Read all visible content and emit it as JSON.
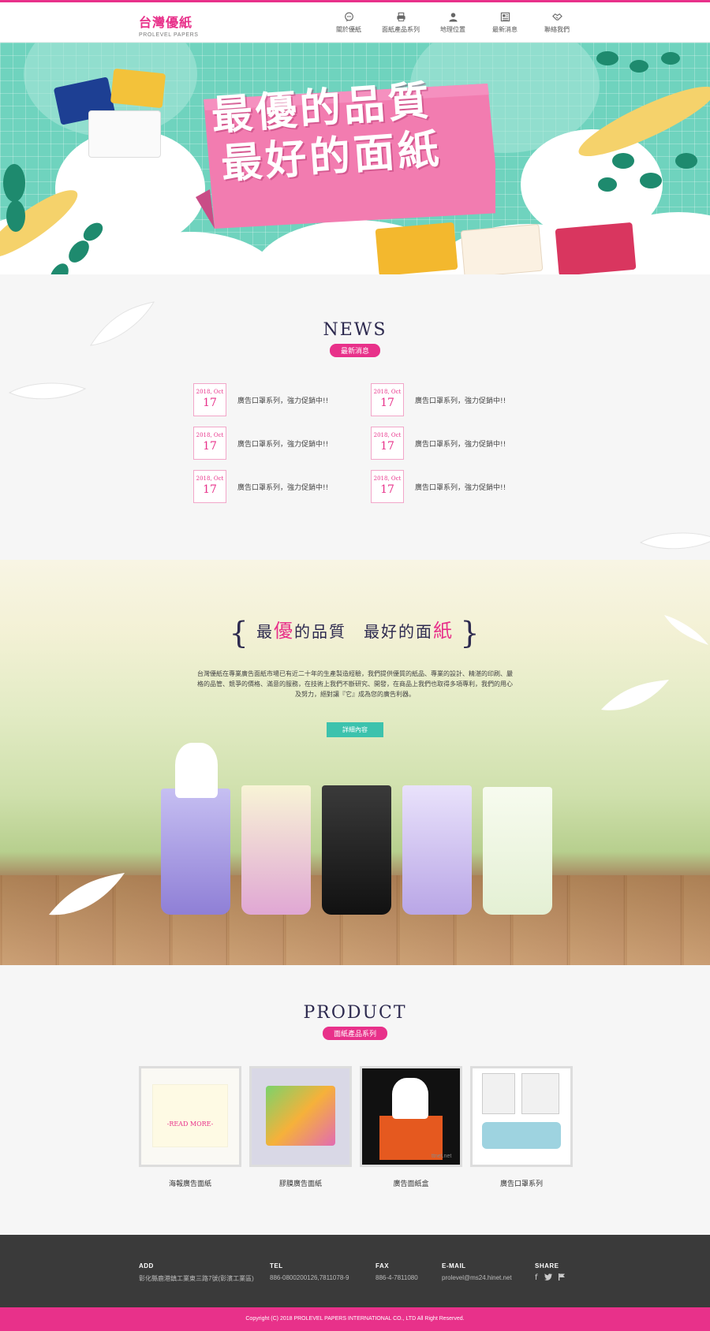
{
  "header": {
    "logo_cn": "台灣優紙",
    "logo_en": "PROLEVEL PAPERS",
    "nav": [
      {
        "label": "關於優紙",
        "icon": "speech-bubble-icon"
      },
      {
        "label": "面紙產品系列",
        "icon": "printer-icon"
      },
      {
        "label": "地理位置",
        "icon": "person-icon"
      },
      {
        "label": "最新消息",
        "icon": "newspaper-icon"
      },
      {
        "label": "聯絡我們",
        "icon": "handshake-icon"
      }
    ]
  },
  "banner": {
    "headline_line1": "最優的品質",
    "headline_line2": "最好的面紙"
  },
  "news": {
    "title": "NEWS",
    "subtitle": "最新消息",
    "items": [
      {
        "ym": "2018, Oct",
        "day": "17",
        "text": "廣告口罩系列，強力促銷中!!"
      },
      {
        "ym": "2018, Oct",
        "day": "17",
        "text": "廣告口罩系列，強力促銷中!!"
      },
      {
        "ym": "2018, Oct",
        "day": "17",
        "text": "廣告口罩系列，強力促銷中!!"
      },
      {
        "ym": "2018, Oct",
        "day": "17",
        "text": "廣告口罩系列，強力促銷中!!"
      },
      {
        "ym": "2018, Oct",
        "day": "17",
        "text": "廣告口罩系列，強力促銷中!!"
      },
      {
        "ym": "2018, Oct",
        "day": "17",
        "text": "廣告口罩系列，強力促銷中!!"
      }
    ]
  },
  "about": {
    "title_a1": "最",
    "title_a2": "優",
    "title_a3": "的品質　最好的面",
    "title_a4": "紙",
    "paragraph": "台灣優紙在專業廣告面紙市場已有近二十年的生產製造經驗，我們提供優質的紙品、專業的設計、精湛的印刷、嚴格的品管、競爭的價格、滿意的服務，在技術上我們不斷研究、開發，在商品上我們也取得多項專利，我們的用心及努力，絕對讓『它』成為您的廣告利器。",
    "button": "詳細內容"
  },
  "product": {
    "title": "PRODUCT",
    "subtitle": "面紙產品系列",
    "read_more": "-READ MORE-",
    "watermark": "ttnet.net",
    "items": [
      {
        "name": "海報廣告面紙"
      },
      {
        "name": "膠膜廣告面紙"
      },
      {
        "name": "廣告面紙盒"
      },
      {
        "name": "廣告口罩系列"
      }
    ]
  },
  "footer": {
    "add_label": "ADD",
    "add_value": "彰化縣鹿港鎮工業東三路7號(彰濱工業區)",
    "tel_label": "TEL",
    "tel_value": "886-0800200126,7811078-9",
    "fax_label": "FAX",
    "fax_value": "886-4-7811080",
    "email_label": "E-MAIL",
    "email_value": "prolevel@ms24.hinet.net",
    "share_label": "SHARE",
    "copyright": "Copyright (C) 2018 PROLEVEL PAPERS INTERNATIONAL CO., LTD All Right Reserved."
  },
  "colors": {
    "accent": "#e8318a",
    "teal": "#3cc2ad",
    "navy": "#2d2a4f",
    "footer": "#3a3a3a"
  }
}
